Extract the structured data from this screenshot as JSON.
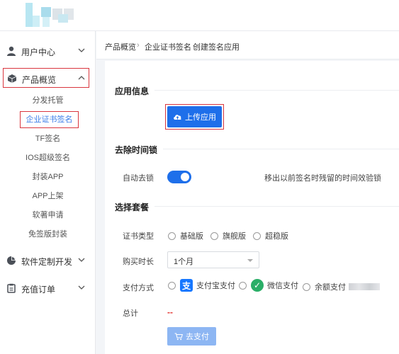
{
  "sidebar": {
    "groups": [
      {
        "label": "用户中心",
        "icon": "user-icon"
      },
      {
        "label": "产品概览",
        "icon": "cube-icon"
      },
      {
        "label": "软件定制开发",
        "icon": "pie-chart-icon"
      },
      {
        "label": "充值订单",
        "icon": "clipboard-icon"
      }
    ],
    "sub_items": [
      "分发托管",
      "企业证书签名",
      "TF签名",
      "IOS超级签名",
      "封装APP",
      "APP上架",
      "软著申请",
      "免签版封装"
    ]
  },
  "breadcrumb": {
    "items": [
      "产品概览",
      "企业证书签名",
      "创建签名应用"
    ],
    "separator": "›"
  },
  "form": {
    "app_info_title": "应用信息",
    "upload_label": "上传应用",
    "time_lock_title": "去除时间锁",
    "auto_unlock_label": "自动去锁",
    "auto_unlock_on": true,
    "auto_unlock_hint": "移出以前签名时残留的时间效验锁",
    "package_title": "选择套餐",
    "cert_type_label": "证书类型",
    "cert_types": [
      "基础版",
      "旗舰版",
      "超稳版"
    ],
    "duration_label": "购买时长",
    "duration_value": "1个月",
    "pay_method_label": "支付方式",
    "pay_methods": [
      "支付宝支付",
      "微信支付",
      "余额支付"
    ],
    "total_label": "总计",
    "total_value": "--",
    "pay_button": "去支付"
  },
  "colors": {
    "primary": "#1e6fea",
    "highlight": "#d9363e",
    "alipay": "#1677ff",
    "wechat": "#2aae67"
  }
}
